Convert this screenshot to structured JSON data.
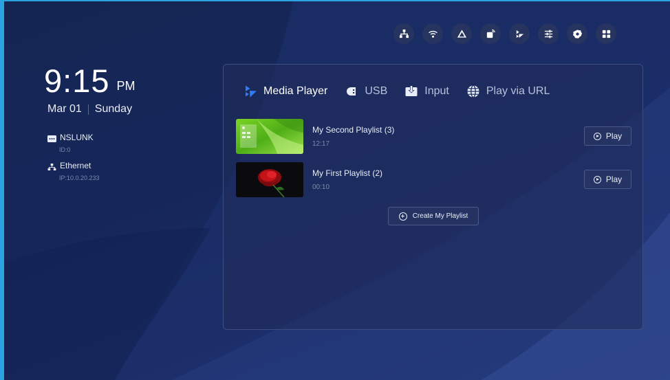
{
  "status_icons": [
    {
      "name": "network-icon"
    },
    {
      "name": "wifi-icon"
    },
    {
      "name": "cast-icon"
    },
    {
      "name": "screen-lock-icon"
    },
    {
      "name": "media-player-icon"
    },
    {
      "name": "sliders-icon"
    },
    {
      "name": "gear-icon"
    },
    {
      "name": "apps-grid-icon"
    }
  ],
  "clock": {
    "time": "9:15",
    "ampm": "PM",
    "date": "Mar 01",
    "weekday": "Sunday"
  },
  "devices": [
    {
      "icon": "device-icon",
      "name": "NSLUNK",
      "sub": "ID:0"
    },
    {
      "icon": "ethernet-icon",
      "name": "Ethernet",
      "sub": "IP:10.0.20.233"
    }
  ],
  "tabs": [
    {
      "label": "Media Player",
      "icon": "media-player-icon",
      "active": true
    },
    {
      "label": "USB",
      "icon": "usb-icon",
      "active": false
    },
    {
      "label": "Input",
      "icon": "input-icon",
      "active": false
    },
    {
      "label": "Play via URL",
      "icon": "globe-icon",
      "active": false
    }
  ],
  "playlists": [
    {
      "title": "My Second Playlist (3)",
      "duration": "12:17",
      "play_label": "Play"
    },
    {
      "title": "My First Playlist (2)",
      "duration": "00:10",
      "play_label": "Play"
    }
  ],
  "create_label": "Create My Playlist",
  "colors": {
    "accent_border": "#2aa3e0",
    "brand_blue": "#2f7df6",
    "background": "#16265a"
  }
}
